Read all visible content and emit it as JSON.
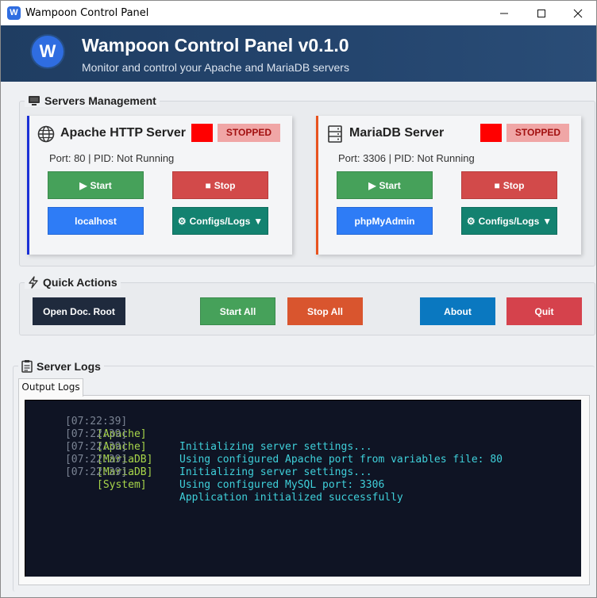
{
  "window": {
    "title": "Wampoon Control Panel",
    "controls": {
      "minimize": "minimize-icon",
      "maximize": "maximize-icon",
      "close": "close-icon"
    }
  },
  "header": {
    "logo_letter": "W",
    "title": "Wampoon Control Panel v0.1.0",
    "subtitle": "Monitor and control your Apache and MariaDB servers"
  },
  "servers": {
    "title": "Servers Management",
    "apache": {
      "name": "Apache HTTP Server",
      "status": "STOPPED",
      "info": "Port: 80 | PID: Not Running",
      "start_label": "Start",
      "stop_label": "Stop",
      "link_label": "localhost",
      "configs_label": "Configs/Logs",
      "accent": "#1a2fd6"
    },
    "mariadb": {
      "name": "MariaDB Server",
      "status": "STOPPED",
      "info": "Port: 3306 | PID: Not Running",
      "start_label": "Start",
      "stop_label": "Stop",
      "link_label": "phpMyAdmin",
      "configs_label": "Configs/Logs",
      "accent": "#e8531f"
    }
  },
  "quick_actions": {
    "title": "Quick Actions",
    "open_doc_root": "Open Doc. Root",
    "start_all": "Start All",
    "stop_all": "Stop All",
    "about": "About",
    "quit": "Quit"
  },
  "logs": {
    "title": "Server Logs",
    "tab_label": "Output Logs",
    "entries": [
      {
        "time": "[07:22:39]",
        "tag": "[Apache]",
        "message": "Initializing server settings..."
      },
      {
        "time": "[07:22:39]",
        "tag": "[Apache]",
        "message": "Using configured Apache port from variables file: 80"
      },
      {
        "time": "[07:22:39]",
        "tag": "[MariaDB]",
        "message": "Initializing server settings..."
      },
      {
        "time": "[07:22:39]",
        "tag": "[MariaDB]",
        "message": "Using configured MySQL port: 3306"
      },
      {
        "time": "[07:22:39]",
        "tag": "[System]",
        "message": "Application initialized successfully"
      }
    ]
  },
  "colors": {
    "header_bg": "#24456e",
    "status_indicator": "#ff0000",
    "console_bg": "#0f1424",
    "log_tag": "#a8d64a",
    "log_message": "#3fd0da"
  }
}
